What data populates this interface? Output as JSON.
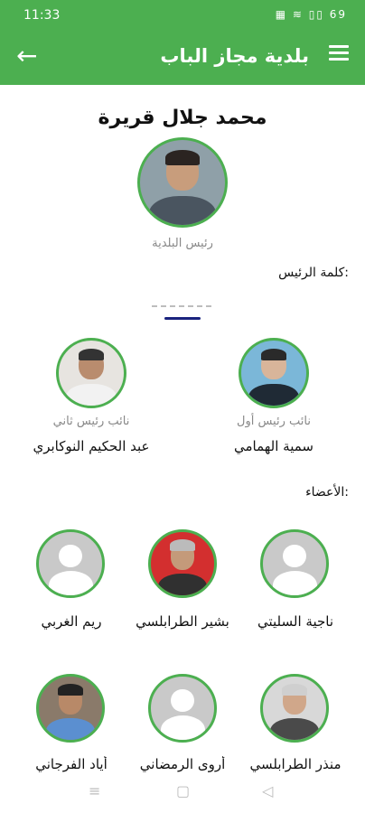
{
  "status": {
    "time": "11:33",
    "icons": "▦ ≋ ▯▯ 69"
  },
  "appbar": {
    "title": "بلدية مجاز الباب",
    "back_icon": "arrow-left-icon",
    "menu_icon": "hamburger-menu-icon"
  },
  "mayor": {
    "name": "محمد جلال قريرة",
    "role": "رئيس البلدية"
  },
  "speech_label": "كلمة الرئيس:",
  "deputies": [
    {
      "role": "نائب رئيس أول",
      "name": "سمية الهمامي"
    },
    {
      "role": "نائب رئيس ثاني",
      "name": "عبد الحكيم النوكابري"
    }
  ],
  "members_label": "الأعضاء:",
  "members": [
    {
      "name": "ناجية السليتي"
    },
    {
      "name": "بشير الطرابلسي"
    },
    {
      "name": "ريم الغربي"
    },
    {
      "name": "منذر الطرابلسي"
    },
    {
      "name": "أروى الرمضاني"
    },
    {
      "name": "أياد الفرجاني"
    }
  ],
  "nav": {
    "recent": "≡",
    "home": "▢",
    "back": "◁"
  }
}
